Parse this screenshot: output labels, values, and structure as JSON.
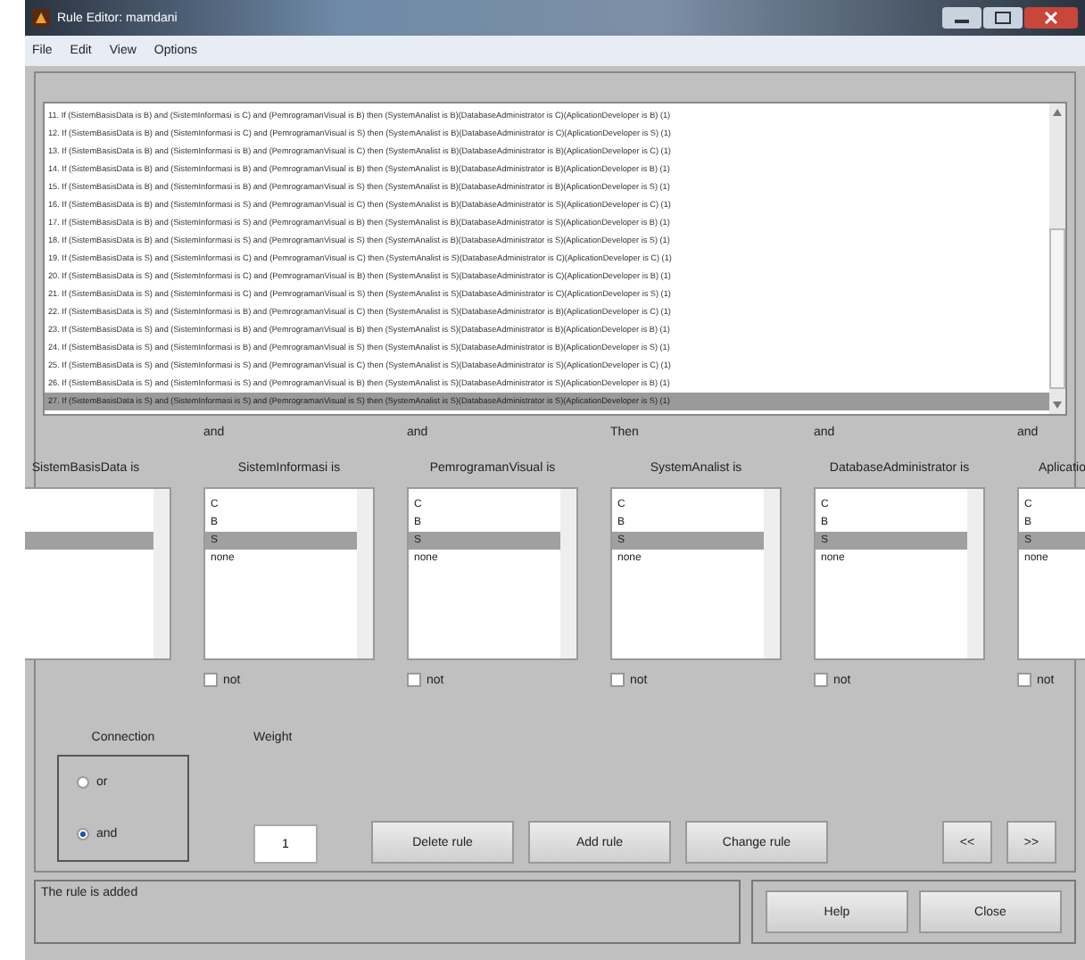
{
  "window": {
    "title": "Rule Editor: mamdani"
  },
  "menu": [
    "File",
    "Edit",
    "View",
    "Options"
  ],
  "rules": [
    {
      "text": "11. If (SistemBasisData is B) and (SistemInformasi is C) and (PemrogramanVisual is B) then (SystemAnalist is B)(DatabaseAdministrator is C)(AplicationDeveloper is B) (1)",
      "selected": false
    },
    {
      "text": "12. If (SistemBasisData is B) and (SistemInformasi is C) and (PemrogramanVisual is S) then (SystemAnalist is B)(DatabaseAdministrator is C)(AplicationDeveloper is S) (1)",
      "selected": false
    },
    {
      "text": "13. If (SistemBasisData is B) and (SistemInformasi is B) and (PemrogramanVisual is C) then (SystemAnalist is B)(DatabaseAdministrator is B)(AplicationDeveloper is C) (1)",
      "selected": false
    },
    {
      "text": "14. If (SistemBasisData is B) and (SistemInformasi is B) and (PemrogramanVisual is B) then (SystemAnalist is B)(DatabaseAdministrator is B)(AplicationDeveloper is B) (1)",
      "selected": false
    },
    {
      "text": "15. If (SistemBasisData is B) and (SistemInformasi is B) and (PemrogramanVisual is S) then (SystemAnalist is B)(DatabaseAdministrator is B)(AplicationDeveloper is S) (1)",
      "selected": false
    },
    {
      "text": "16. If (SistemBasisData is B) and (SistemInformasi is S) and (PemrogramanVisual is C) then (SystemAnalist is B)(DatabaseAdministrator is S)(AplicationDeveloper is C) (1)",
      "selected": false
    },
    {
      "text": "17. If (SistemBasisData is B) and (SistemInformasi is S) and (PemrogramanVisual is B) then (SystemAnalist is B)(DatabaseAdministrator is S)(AplicationDeveloper is B) (1)",
      "selected": false
    },
    {
      "text": "18. If (SistemBasisData is B) and (SistemInformasi is S) and (PemrogramanVisual is S) then (SystemAnalist is B)(DatabaseAdministrator is S)(AplicationDeveloper is S) (1)",
      "selected": false
    },
    {
      "text": "19. If (SistemBasisData is S) and (SistemInformasi is C) and (PemrogramanVisual is C) then (SystemAnalist is S)(DatabaseAdministrator is C)(AplicationDeveloper is C) (1)",
      "selected": false
    },
    {
      "text": "20. If (SistemBasisData is S) and (SistemInformasi is C) and (PemrogramanVisual is B) then (SystemAnalist is S)(DatabaseAdministrator is C)(AplicationDeveloper is B) (1)",
      "selected": false
    },
    {
      "text": "21. If (SistemBasisData is S) and (SistemInformasi is C) and (PemrogramanVisual is S) then (SystemAnalist is S)(DatabaseAdministrator is C)(AplicationDeveloper is S) (1)",
      "selected": false
    },
    {
      "text": "22. If (SistemBasisData is S) and (SistemInformasi is B) and (PemrogramanVisual is C) then (SystemAnalist is S)(DatabaseAdministrator is B)(AplicationDeveloper is C) (1)",
      "selected": false
    },
    {
      "text": "23. If (SistemBasisData is S) and (SistemInformasi is B) and (PemrogramanVisual is B) then (SystemAnalist is S)(DatabaseAdministrator is B)(AplicationDeveloper is B) (1)",
      "selected": false
    },
    {
      "text": "24. If (SistemBasisData is S) and (SistemInformasi is B) and (PemrogramanVisual is S) then (SystemAnalist is S)(DatabaseAdministrator is B)(AplicationDeveloper is S) (1)",
      "selected": false
    },
    {
      "text": "25. If (SistemBasisData is S) and (SistemInformasi is S) and (PemrogramanVisual is C) then (SystemAnalist is S)(DatabaseAdministrator is S)(AplicationDeveloper is C) (1)",
      "selected": false
    },
    {
      "text": "26. If (SistemBasisData is S) and (SistemInformasi is S) and (PemrogramanVisual is B) then (SystemAnalist is S)(DatabaseAdministrator is S)(AplicationDeveloper is B) (1)",
      "selected": false
    },
    {
      "text": "27. If (SistemBasisData is S) and (SistemInformasi is S) and (PemrogramanVisual is S) then (SystemAnalist is S)(DatabaseAdministrator is S)(AplicationDeveloper is S) (1)",
      "selected": true
    }
  ],
  "variables": [
    {
      "label": "SistemBasisData is",
      "items": [
        {
          "selected": false
        },
        {
          "selected": false
        },
        {
          "selected": true
        }
      ]
    },
    {
      "connector": "and",
      "label": "SistemInformasi is",
      "items": [
        {
          "label": "C",
          "selected": false
        },
        {
          "label": "B",
          "selected": false
        },
        {
          "label": "S",
          "selected": true
        },
        {
          "label": "none",
          "selected": false
        }
      ],
      "not": {
        "label": "not",
        "checked": false
      }
    },
    {
      "connector": "and",
      "label": "PemrogramanVisual is",
      "items": [
        {
          "label": "C",
          "selected": false
        },
        {
          "label": "B",
          "selected": false
        },
        {
          "label": "S",
          "selected": true
        },
        {
          "label": "none",
          "selected": false
        }
      ],
      "not": {
        "label": "not",
        "checked": false
      }
    },
    {
      "connector": "Then",
      "label": "SystemAnalist is",
      "items": [
        {
          "label": "C",
          "selected": false
        },
        {
          "label": "B",
          "selected": false
        },
        {
          "label": "S",
          "selected": true
        },
        {
          "label": "none",
          "selected": false
        }
      ],
      "not": {
        "label": "not",
        "checked": false
      }
    },
    {
      "connector": "and",
      "label": "DatabaseAdministrator is",
      "items": [
        {
          "label": "C",
          "selected": false
        },
        {
          "label": "B",
          "selected": false
        },
        {
          "label": "S",
          "selected": true
        },
        {
          "label": "none",
          "selected": false
        }
      ],
      "not": {
        "label": "not",
        "checked": false
      }
    },
    {
      "connector": "and",
      "label": "Aplicatio",
      "items": [
        {
          "label": "C",
          "selected": false
        },
        {
          "label": "B",
          "selected": false
        },
        {
          "label": "S",
          "selected": true
        },
        {
          "label": "none",
          "selected": false
        }
      ],
      "not": {
        "label": "not",
        "checked": false
      }
    }
  ],
  "connection": {
    "title": "Connection",
    "options": [
      {
        "label": "or",
        "selected": false
      },
      {
        "label": "and",
        "selected": true
      }
    ]
  },
  "weight": {
    "label": "Weight",
    "value": "1"
  },
  "buttons": [
    "Delete rule",
    "Add rule",
    "Change rule",
    "<<",
    ">>"
  ],
  "status": "The rule is added",
  "footer_buttons": [
    "Help",
    "Close"
  ]
}
